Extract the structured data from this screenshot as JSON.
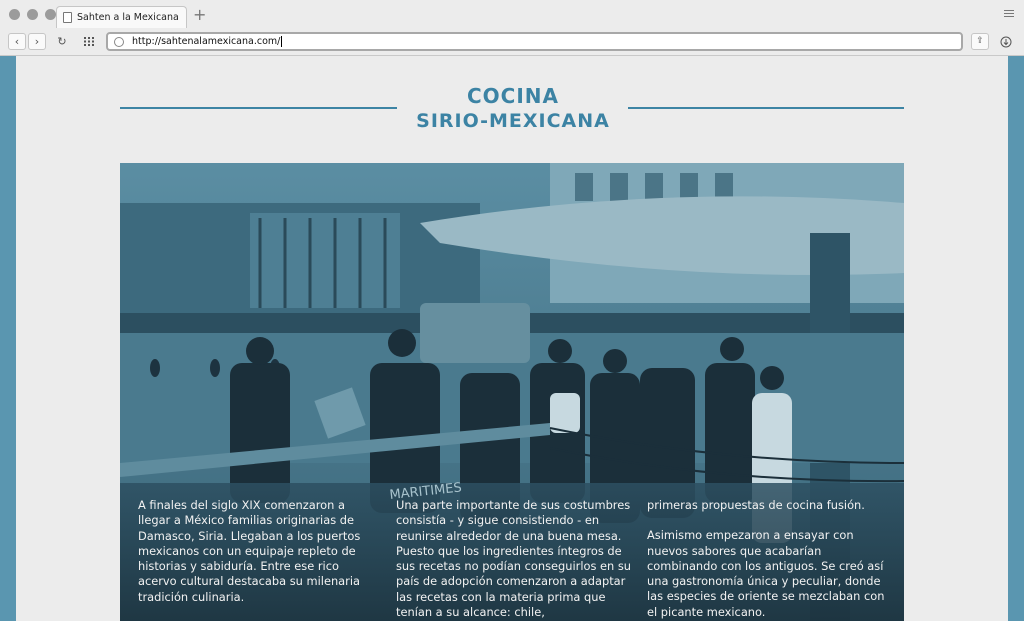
{
  "browser": {
    "tab_title": "Sahten a la Mexicana",
    "new_tab": "+",
    "url": "http://sahtenalamexicana.com/"
  },
  "header": {
    "line1": "COCINA",
    "line2": "SIRIO-MEXICANA"
  },
  "article": {
    "col1": "A finales del siglo XIX comenzaron a llegar a México familias originarias de Damasco, Siria. Llegaban a los puertos mexicanos con un equipaje repleto de historias y sabiduría. Entre ese rico acervo cultural destacaba su milenaria tradición culinaria.",
    "col2": "Una parte importante de sus costumbres consistía - y sigue consistiendo - en reunirse alrededor de una buena mesa. Puesto que los ingredientes íntegros de sus recetas no podían conseguirlos en su país de adopción comenzaron a adaptar las recetas con la materia prima que tenían a su alcance: chile,",
    "col3_p1": "primeras propuestas de cocina fusión.",
    "col3_p2": "Asimismo empezaron a ensayar con nuevos sabores que  acabarían combinando con los antiguos. Se creó así una gastronomía única y peculiar, donde las especies de oriente se mezclaban con el picante mexicano."
  },
  "photo": {
    "hull_text": "MARITIMES"
  },
  "colors": {
    "accent": "#3c83a4",
    "frame": "#5a96b0",
    "background": "#ececec"
  }
}
